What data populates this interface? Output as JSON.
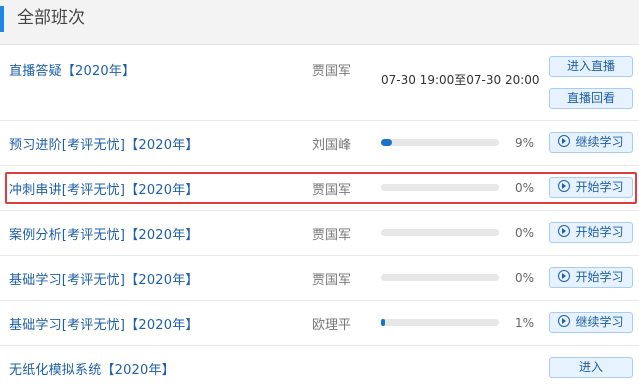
{
  "header": {
    "title": "全部班次"
  },
  "rows": [
    {
      "name": "直播答疑【2020年】",
      "teacher": "贾国军",
      "time": "07-30 19:00至07-30 20:00",
      "buttons": [
        "进入直播",
        "直播回看"
      ]
    },
    {
      "name": "预习进阶[考评无忧]【2020年】",
      "teacher": "刘国峰",
      "progress": 0.09,
      "pct": "9%",
      "button": "继续学习"
    },
    {
      "name": "冲刺串讲[考评无忧]【2020年】",
      "teacher": "贾国军",
      "progress": 0,
      "pct": "0%",
      "button": "开始学习"
    },
    {
      "name": "案例分析[考评无忧]【2020年】",
      "teacher": "贾国军",
      "progress": 0,
      "pct": "0%",
      "button": "开始学习"
    },
    {
      "name": "基础学习[考评无忧]【2020年】",
      "teacher": "贾国军",
      "progress": 0,
      "pct": "0%",
      "button": "开始学习"
    },
    {
      "name": "基础学习[考评无忧]【2020年】",
      "teacher": "欧理平",
      "progress": 0.01,
      "pct": "1%",
      "button": "继续学习"
    },
    {
      "name": "无纸化模拟系统【2020年】",
      "button": "进入"
    }
  ],
  "colors": {
    "accent": "#1e88e5",
    "link": "#1e5faa",
    "highlight": "#e03c3c",
    "progress_fill": "#1a73c8"
  },
  "icons": {
    "play": "play-circle-icon"
  }
}
